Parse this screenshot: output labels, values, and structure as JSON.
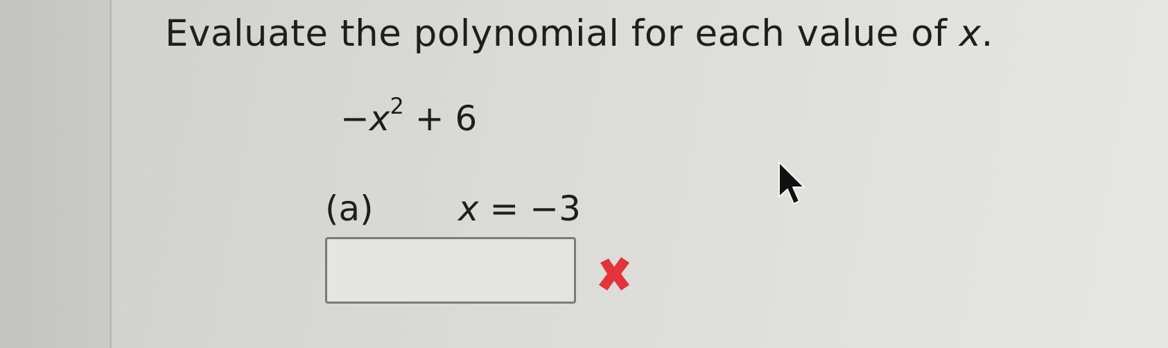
{
  "question": {
    "instruction_prefix": "Evaluate the polynomial for each value of ",
    "instruction_var": "x",
    "instruction_suffix": ".",
    "polynomial": {
      "prefix": "−",
      "var": "x",
      "exponent": "2",
      "rest": " + 6"
    },
    "part_a": {
      "label": "(a)",
      "var": "x",
      "equals": " = −3"
    },
    "answer_value": "",
    "feedback_icon": "incorrect-x-icon",
    "feedback_color": "#e2343a"
  },
  "cursor": {
    "icon": "mouse-pointer-icon"
  }
}
